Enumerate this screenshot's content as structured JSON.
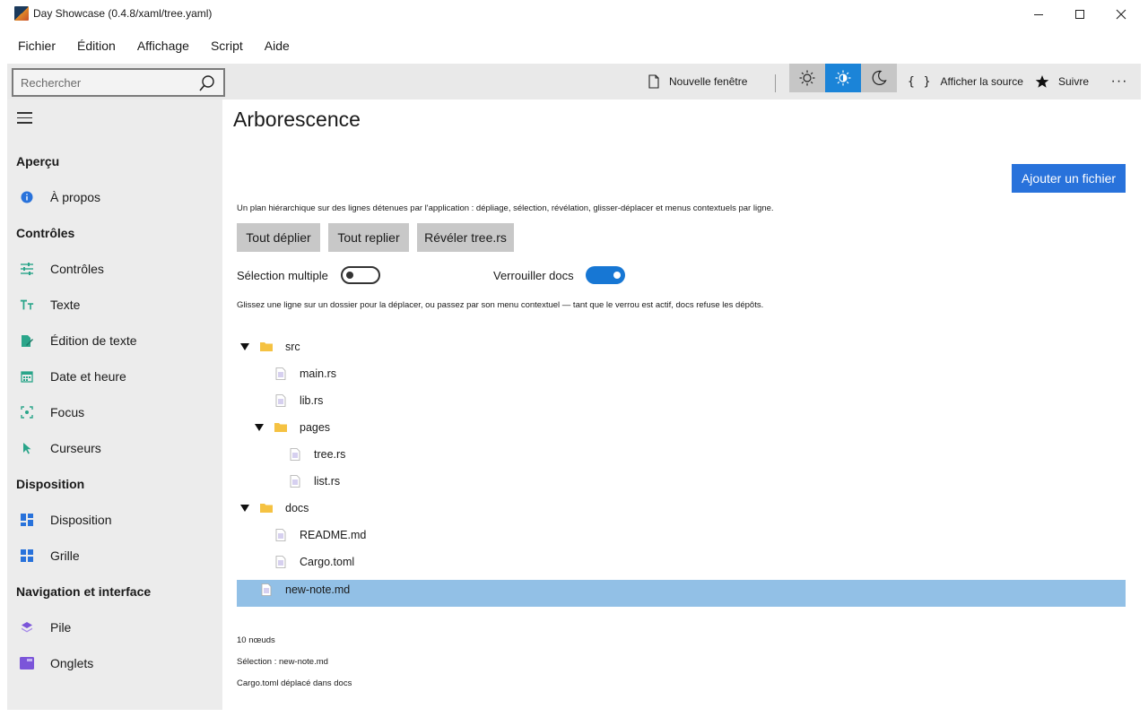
{
  "window": {
    "title": "Day Showcase (0.4.8/xaml/tree.yaml)",
    "controls": {
      "minimize": "minimize",
      "maximize": "maximize",
      "close": "close"
    }
  },
  "menu": [
    "Fichier",
    "Édition",
    "Affichage",
    "Script",
    "Aide"
  ],
  "toolbar": {
    "search_placeholder": "Rechercher",
    "new_window": "Nouvelle fenêtre",
    "theme_modes": [
      "light",
      "auto",
      "dark"
    ],
    "theme_selected": "auto",
    "show_source": "Afficher la source",
    "follow": "Suivre",
    "more": "···"
  },
  "sidebar": {
    "sections": [
      {
        "title": "Aperçu",
        "items": [
          {
            "label": "À propos",
            "icon": "info-icon",
            "color": "#2872db"
          }
        ]
      },
      {
        "title": "Contrôles",
        "items": [
          {
            "label": "Contrôles",
            "icon": "sliders-icon",
            "color": "#2aa58a"
          },
          {
            "label": "Texte",
            "icon": "text-size-icon",
            "color": "#2aa58a"
          },
          {
            "label": "Édition de texte",
            "icon": "edit-document-icon",
            "color": "#2aa58a"
          },
          {
            "label": "Date et heure",
            "icon": "calendar-icon",
            "color": "#2aa58a"
          },
          {
            "label": "Focus",
            "icon": "focus-icon",
            "color": "#2aa58a"
          },
          {
            "label": "Curseurs",
            "icon": "cursor-icon",
            "color": "#2aa58a"
          }
        ]
      },
      {
        "title": "Disposition",
        "items": [
          {
            "label": "Disposition",
            "icon": "layout-icon",
            "color": "#2872db"
          },
          {
            "label": "Grille",
            "icon": "grid-icon",
            "color": "#2872db"
          }
        ]
      },
      {
        "title": "Navigation et interface",
        "items": [
          {
            "label": "Pile",
            "icon": "stack-icon",
            "color": "#7b55d9"
          },
          {
            "label": "Onglets",
            "icon": "tabs-icon",
            "color": "#7b55d9"
          }
        ]
      }
    ]
  },
  "main": {
    "title": "Arborescence",
    "add_file_button": "Ajouter un fichier",
    "description": "Un plan hiérarchique sur des lignes détenues par l'application : dépliage, sélection, révélation, glisser-déplacer et menus contextuels par ligne.",
    "buttons": {
      "expand_all": "Tout déplier",
      "collapse_all": "Tout replier",
      "reveal": "Révéler tree.rs"
    },
    "toggles": {
      "multi_select": {
        "label": "Sélection multiple",
        "on": false
      },
      "lock_docs": {
        "label": "Verrouiller docs",
        "on": true
      }
    },
    "hint": "Glissez une ligne sur un dossier pour la déplacer, ou passez par son menu contextuel — tant que le verrou est actif, docs refuse les dépôts.",
    "tree": [
      {
        "label": "src",
        "kind": "folder",
        "depth": 0,
        "expanded": true,
        "selected": false
      },
      {
        "label": "main.rs",
        "kind": "file",
        "depth": 1,
        "selected": false
      },
      {
        "label": "lib.rs",
        "kind": "file",
        "depth": 1,
        "selected": false
      },
      {
        "label": "pages",
        "kind": "folder",
        "depth": 1,
        "expanded": true,
        "selected": false
      },
      {
        "label": "tree.rs",
        "kind": "file",
        "depth": 2,
        "selected": false
      },
      {
        "label": "list.rs",
        "kind": "file",
        "depth": 2,
        "selected": false
      },
      {
        "label": "docs",
        "kind": "folder",
        "depth": 0,
        "expanded": true,
        "selected": false
      },
      {
        "label": "README.md",
        "kind": "file",
        "depth": 1,
        "selected": false
      },
      {
        "label": "Cargo.toml",
        "kind": "file",
        "depth": 1,
        "selected": false
      },
      {
        "label": "new-note.md",
        "kind": "file",
        "depth": 0,
        "selected": true
      }
    ],
    "status": {
      "count": "10 nœuds",
      "selection": "Sélection : new-note.md",
      "last_action": "Cargo.toml déplacé dans docs"
    }
  },
  "colors": {
    "accent": "#2872db",
    "toggle_on": "#1777d4",
    "selected_row": "#92c0e6",
    "folder": "#f5c242",
    "sidebar_bg": "#ececec"
  }
}
